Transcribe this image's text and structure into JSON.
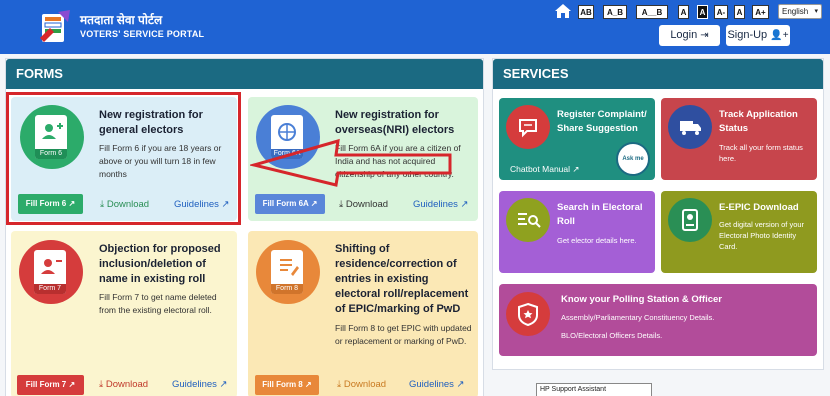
{
  "header": {
    "brand_hindi": "मतदाता सेवा पोर्टल",
    "brand_english": "VOTERS' SERVICE PORTAL",
    "accessibility": [
      "AB",
      "A_B",
      "A__B",
      "A",
      "A",
      "A-",
      "A",
      "A+"
    ],
    "language": "English",
    "login_label": "Login",
    "signup_label": "Sign-Up"
  },
  "forms": {
    "title": "FORMS",
    "cards": [
      {
        "title": "New registration for general electors",
        "desc": "Fill Form 6 if you are 18 years or above or you will turn 18 in few months",
        "form_badge": "Form 6",
        "button": "Fill Form 6",
        "download": "Download",
        "guidelines": "Guidelines"
      },
      {
        "title": "New registration for overseas(NRI) electors",
        "desc": "Fill Form 6A if you are a citizen of India and has not acquired citizenship of any other country.",
        "form_badge": "Form 6A",
        "button": "Fill Form 6A",
        "download": "Download",
        "guidelines": "Guidelines"
      },
      {
        "title": "Objection for proposed inclusion/deletion of name in existing roll",
        "desc": "Fill Form 7 to get name deleted from the existing electoral roll.",
        "form_badge": "Form 7",
        "button": "Fill Form 7",
        "download": "Download",
        "guidelines": "Guidelines"
      },
      {
        "title": "Shifting of residence/correction of entries in existing electoral roll/replacement of EPIC/marking of PwD",
        "desc": "Fill Form 8 to get EPIC with updated or replacement or marking of PwD.",
        "form_badge": "Form 8",
        "button": "Fill Form 8",
        "download": "Download",
        "guidelines": "Guidelines"
      }
    ]
  },
  "services": {
    "title": "SERVICES",
    "cards": [
      {
        "title": "Register Complaint/ Share Suggestion",
        "desc": "",
        "extra": "Chatbot Manual",
        "badge": "Ask me"
      },
      {
        "title": "Track Application Status",
        "desc": "Track all your form status here."
      },
      {
        "title": "Search in Electoral Roll",
        "desc": "Get elector details here."
      },
      {
        "title": "E-EPIC Download",
        "desc": "Get digital version of your Electoral Photo Identity Card."
      },
      {
        "title": "Know your Polling Station & Officer",
        "desc": "Assembly/Parliamentary Constituency Details.",
        "desc2": "BLO/Electoral Officers Details."
      }
    ]
  },
  "tooltip": "HP Support Assistant",
  "colors": {
    "header_blue": "#1f63d3",
    "panel_head": "#1b6a82",
    "highlight_red": "#d6262b"
  }
}
